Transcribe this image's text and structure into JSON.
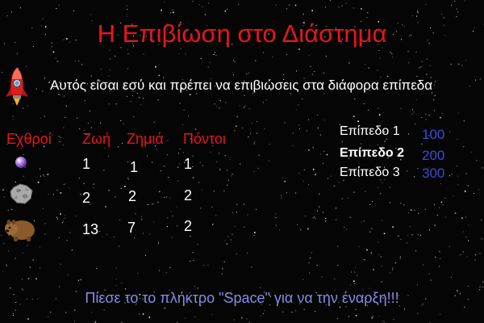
{
  "title": "Η Επιβίωση στο Διάστημα",
  "intro": "Αυτός είσαι εσύ και πρέπει να επιβιώσεις στα διάφορα επίπεδα",
  "player_icon": "rocket-icon",
  "table": {
    "headers": [
      "Εχθροί",
      "Ζωή",
      "Ζημιά",
      "Πόντοι"
    ],
    "rows": [
      {
        "enemy_icon": "purple-orb-icon",
        "life": "1",
        "damage": "1",
        "points": "1"
      },
      {
        "enemy_icon": "asteroid-icon",
        "life": "2",
        "damage": "2",
        "points": "2"
      },
      {
        "enemy_icon": "wombat-icon",
        "life": "13",
        "damage": "7",
        "points": "2"
      }
    ]
  },
  "levels": [
    {
      "name": "Επίπεδο 1",
      "score": "100",
      "active": false
    },
    {
      "name": "Επίπεδο 2",
      "score": "200",
      "active": true
    },
    {
      "name": "Επίπεδο 3",
      "score": "300",
      "active": false
    }
  ],
  "footer": "Πίεσε το το πλήκτρο \"Space\" για να την έναρξη!!!",
  "colors": {
    "background": "#050505",
    "title": "#e8151b",
    "headers": "#e8151b",
    "level_score": "#3c4bd6",
    "footer": "#8a8ae6"
  }
}
